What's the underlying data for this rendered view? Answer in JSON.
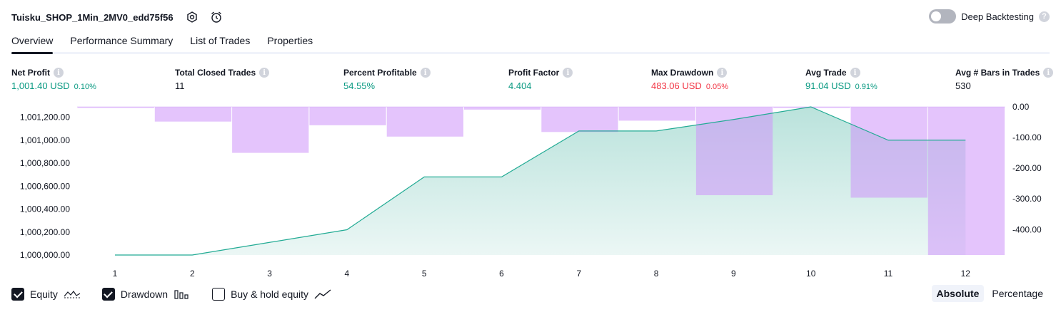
{
  "strategy": {
    "title": "Tuisku_SHOP_1Min_2MV0_edd75f56"
  },
  "deep_backtesting": {
    "label": "Deep Backtesting",
    "enabled": false
  },
  "tabs": [
    {
      "label": "Overview",
      "active": true
    },
    {
      "label": "Performance Summary",
      "active": false
    },
    {
      "label": "List of Trades",
      "active": false
    },
    {
      "label": "Properties",
      "active": false
    }
  ],
  "stats": [
    {
      "label": "Net Profit",
      "value": "1,001.40 USD",
      "pct": "0.10%",
      "color": "#089981"
    },
    {
      "label": "Total Closed Trades",
      "value": "11",
      "pct": "",
      "color": "#131722"
    },
    {
      "label": "Percent Profitable",
      "value": "54.55%",
      "pct": "",
      "color": "#089981"
    },
    {
      "label": "Profit Factor",
      "value": "4.404",
      "pct": "",
      "color": "#089981"
    },
    {
      "label": "Max Drawdown",
      "value": "483.06 USD",
      "pct": "0.05%",
      "color": "#f23645"
    },
    {
      "label": "Avg Trade",
      "value": "91.04 USD",
      "pct": "0.91%",
      "color": "#089981"
    },
    {
      "label": "Avg # Bars in Trades",
      "value": "530",
      "pct": "",
      "color": "#131722"
    }
  ],
  "chart_data": {
    "type": "area",
    "x": [
      1,
      2,
      3,
      4,
      5,
      6,
      7,
      8,
      9,
      10,
      11,
      12
    ],
    "series": [
      {
        "name": "Equity",
        "type": "area",
        "axis": "left",
        "values": [
          1000000.0,
          1000000.0,
          1000110.0,
          1000220.0,
          1000680.0,
          1000680.0,
          1001080.0,
          1001080.0,
          1001180.0,
          1001290.0,
          1001000.0,
          1001000.0
        ]
      },
      {
        "name": "Drawdown",
        "type": "bar",
        "axis": "right",
        "values": [
          -1,
          -48,
          -150,
          -60,
          -97,
          -9,
          -82,
          -45,
          -288,
          -2,
          -296,
          -483
        ]
      }
    ],
    "left_axis": {
      "ticks": [
        "1,000,000.00",
        "1,000,200.00",
        "1,000,400.00",
        "1,000,600.00",
        "1,000,800.00",
        "1,001,000.00",
        "1,001,200.00"
      ],
      "range": [
        1000000,
        1001290
      ]
    },
    "right_axis": {
      "ticks": [
        "0.00",
        "-100.00",
        "-200.00",
        "-300.00",
        "-400.00"
      ],
      "range": [
        -483,
        0
      ]
    },
    "x_ticks": [
      "1",
      "2",
      "3",
      "4",
      "5",
      "6",
      "7",
      "8",
      "9",
      "10",
      "11",
      "12"
    ],
    "colors": {
      "equity_line": "#22ab94",
      "equity_fill": "#089981",
      "drawdown": "#ce93f9"
    },
    "grid": false
  },
  "legend": [
    {
      "label": "Equity",
      "checked": true,
      "icon": "equity-wave-icon"
    },
    {
      "label": "Drawdown",
      "checked": true,
      "icon": "drawdown-bars-icon"
    },
    {
      "label": "Buy & hold equity",
      "checked": false,
      "icon": "buy-hold-line-icon"
    }
  ],
  "view_mode": {
    "options": [
      "Absolute",
      "Percentage"
    ],
    "selected": "Absolute"
  }
}
